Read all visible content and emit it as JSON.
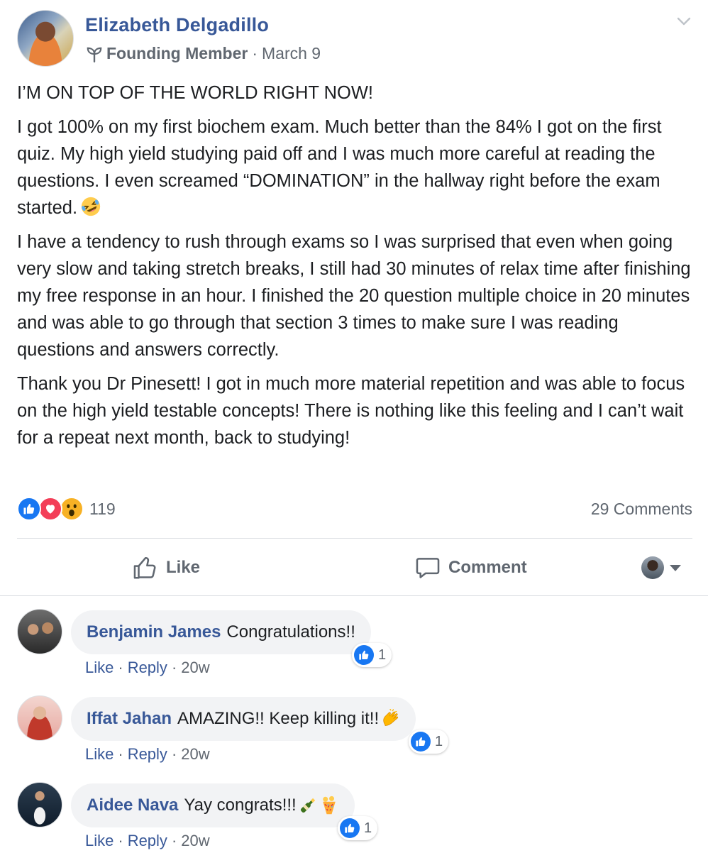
{
  "post": {
    "author": "Elizabeth Delgadillo",
    "badge": "Founding Member",
    "separator": "·",
    "date": "March 9",
    "paragraphs": [
      "I’M ON TOP OF THE WORLD RIGHT NOW!",
      "I got 100% on my first biochem exam. Much better than the 84% I got on the first quiz. My high yield studying paid off and I was much more careful at reading the questions. I even screamed “DOMINATION” in the hallway right before the exam started.",
      "I have a tendency to rush through exams so I was surprised that even when going very slow and taking stretch breaks, I still had 30 minutes of relax time after finishing my free response in an hour. I finished the 20 question multiple choice in 20 minutes and was able to go through that section 3 times to make sure I was reading questions and answers correctly.",
      "Thank you Dr Pinesett! I got in much more material repetition and was able to focus on the high yield testable concepts! There is nothing like this feeling and I can’t wait for a repeat next month, back to studying!"
    ],
    "reaction_count": "119",
    "comment_count": "29 Comments"
  },
  "actions": {
    "like_label": "Like",
    "comment_label": "Comment"
  },
  "comment_actions": {
    "like": "Like",
    "reply": "Reply",
    "dot": "·"
  },
  "comments": [
    {
      "author": "Benjamin James",
      "text": "Congratulations!!",
      "reactions": "1",
      "time": "20w"
    },
    {
      "author": "Iffat Jahan",
      "text": "AMAZING!! Keep killing it!!",
      "reactions": "1",
      "time": "20w"
    },
    {
      "author": "Aidee Nava",
      "text": "Yay congrats!!!",
      "reactions": "1",
      "time": "20w"
    }
  ],
  "colors": {
    "link_blue": "#385898",
    "like_blue": "#1877f2",
    "love_red": "#f33e58",
    "wow_yellow": "#f7b125",
    "meta_gray": "#606770",
    "bubble_bg": "#f2f3f5"
  },
  "icons": {
    "badge": "sprout-icon",
    "menu": "chevron-down-icon",
    "like": "thumbs-up-icon",
    "comment": "speech-bubble-icon",
    "inline_emoji": "rolling-laughing-emoji",
    "comment_2_emoji": "clapping-hands-emoji",
    "comment_3_emoji": [
      "champagne-emoji",
      "confetti-emoji"
    ]
  }
}
